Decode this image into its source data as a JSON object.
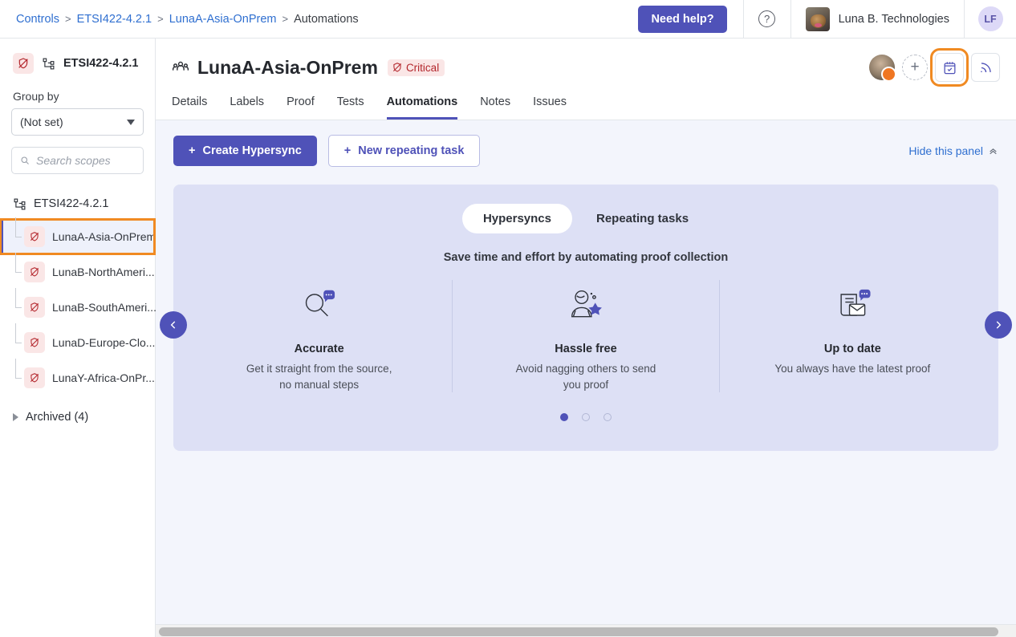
{
  "topbar": {
    "breadcrumb": [
      {
        "label": "Controls",
        "link": true
      },
      {
        "label": "ETSI422-4.2.1",
        "link": true
      },
      {
        "label": "LunaA-Asia-OnPrem",
        "link": true
      },
      {
        "label": "Automations",
        "link": false
      }
    ],
    "separator": ">",
    "need_help_label": "Need help?",
    "help_icon": "question-circle-icon",
    "org_name": "Luna B. Technologies",
    "org_avatar": "dog-photo-avatar",
    "user_initials": "LF"
  },
  "sidebar": {
    "scope_header": {
      "status_icon": "crossed-shield-icon",
      "tree_icon": "hierarchy-icon",
      "title": "ETSI422-4.2.1"
    },
    "group_by_label": "Group by",
    "group_by_value": "(Not set)",
    "search_placeholder": "Search scopes",
    "search_value": "",
    "search_icon": "search-icon",
    "tree_root": {
      "icon": "hierarchy-icon",
      "label": "ETSI422-4.2.1"
    },
    "tree_items": [
      {
        "label": "LunaA-Asia-OnPrem",
        "icon": "crossed-shield-icon",
        "selected": true
      },
      {
        "label": "LunaB-NorthAmeri...",
        "icon": "crossed-shield-icon",
        "selected": false
      },
      {
        "label": "LunaB-SouthAmeri...",
        "icon": "crossed-shield-icon",
        "selected": false
      },
      {
        "label": "LunaD-Europe-Clo...",
        "icon": "crossed-shield-icon",
        "selected": false
      },
      {
        "label": "LunaY-Africa-OnPr...",
        "icon": "crossed-shield-icon",
        "selected": false
      }
    ],
    "archived_label": "Archived (4)",
    "archived_icon": "triangle-right-icon"
  },
  "main": {
    "title_icon": "people-group-icon",
    "title": "LunaA-Asia-OnPrem",
    "status_badge": {
      "label": "Critical",
      "icon": "crossed-shield-icon",
      "color": "#b3262c",
      "background": "#fae6e6"
    },
    "header_actions": [
      {
        "name": "owner-avatar",
        "icon": "person-avatar-key-badge"
      },
      {
        "name": "add-person-button",
        "icon": "plus-icon"
      },
      {
        "name": "tasks-button",
        "icon": "calendar-check-icon",
        "highlighted": true
      },
      {
        "name": "activity-feed-button",
        "icon": "rss-icon",
        "highlighted": false
      }
    ],
    "tabs": [
      {
        "label": "Details",
        "active": false
      },
      {
        "label": "Labels",
        "active": false
      },
      {
        "label": "Proof",
        "active": false
      },
      {
        "label": "Tests",
        "active": false
      },
      {
        "label": "Automations",
        "active": true
      },
      {
        "label": "Notes",
        "active": false
      },
      {
        "label": "Issues",
        "active": false
      }
    ],
    "buttons": {
      "create_hypersync": "Create Hypersync",
      "new_repeating_task": "New repeating task",
      "plus_icon": "plus-icon"
    },
    "hide_panel_label": "Hide this panel",
    "hide_panel_icon": "chevron-double-up-icon"
  },
  "promo": {
    "toggle": [
      {
        "label": "Hypersyncs",
        "active": true
      },
      {
        "label": "Repeating tasks",
        "active": false
      }
    ],
    "subtitle": "Save time and effort by automating proof collection",
    "cards": [
      {
        "art": "magnifier-bubble-icon",
        "title": "Accurate",
        "desc": "Get it straight from the source,\nno manual steps"
      },
      {
        "art": "person-star-icon",
        "title": "Hassle free",
        "desc": "Avoid nagging others to send\nyou proof"
      },
      {
        "art": "document-envelope-bubble-icon",
        "title": "Up to date",
        "desc": "You always have the latest proof"
      }
    ],
    "dots": [
      true,
      false,
      false
    ],
    "prev_icon": "chevron-left-icon",
    "next_icon": "chevron-right-icon"
  },
  "colors": {
    "accent": "#4f52b8",
    "link": "#2f6fd0",
    "highlight_outline": "#f08a22",
    "critical": "#b3262c",
    "panel_bg": "#dde0f5",
    "content_bg": "#f3f5fc"
  }
}
